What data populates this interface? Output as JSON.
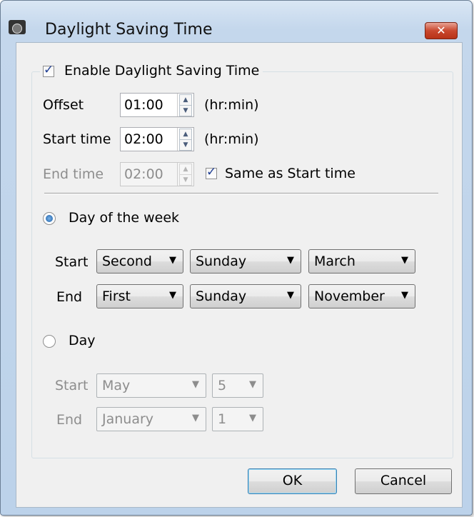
{
  "window": {
    "title": "Daylight Saving Time",
    "close_glyph": "✕"
  },
  "dst": {
    "enable_label": "Enable Daylight Saving Time",
    "offset_label": "Offset",
    "offset_value": "01:00",
    "offset_unit": "(hr:min)",
    "start_label": "Start time",
    "start_value": "02:00",
    "start_unit": "(hr:min)",
    "end_label": "End time",
    "end_value": "02:00",
    "same_label": "Same as Start time"
  },
  "day_of_week": {
    "radio_label": "Day of the week",
    "start_label": "Start",
    "start": [
      "Second",
      "Sunday",
      "March"
    ],
    "end_label": "End",
    "end": [
      "First",
      "Sunday",
      "November"
    ]
  },
  "day": {
    "radio_label": "Day",
    "start_label": "Start",
    "start": [
      "May",
      "5"
    ],
    "end_label": "End",
    "end": [
      "January",
      "1"
    ]
  },
  "buttons": {
    "ok": "OK",
    "cancel": "Cancel"
  },
  "icons": {
    "spin_up": "▲",
    "spin_down": "▼",
    "dropdown": "▼",
    "close": "close-icon"
  }
}
